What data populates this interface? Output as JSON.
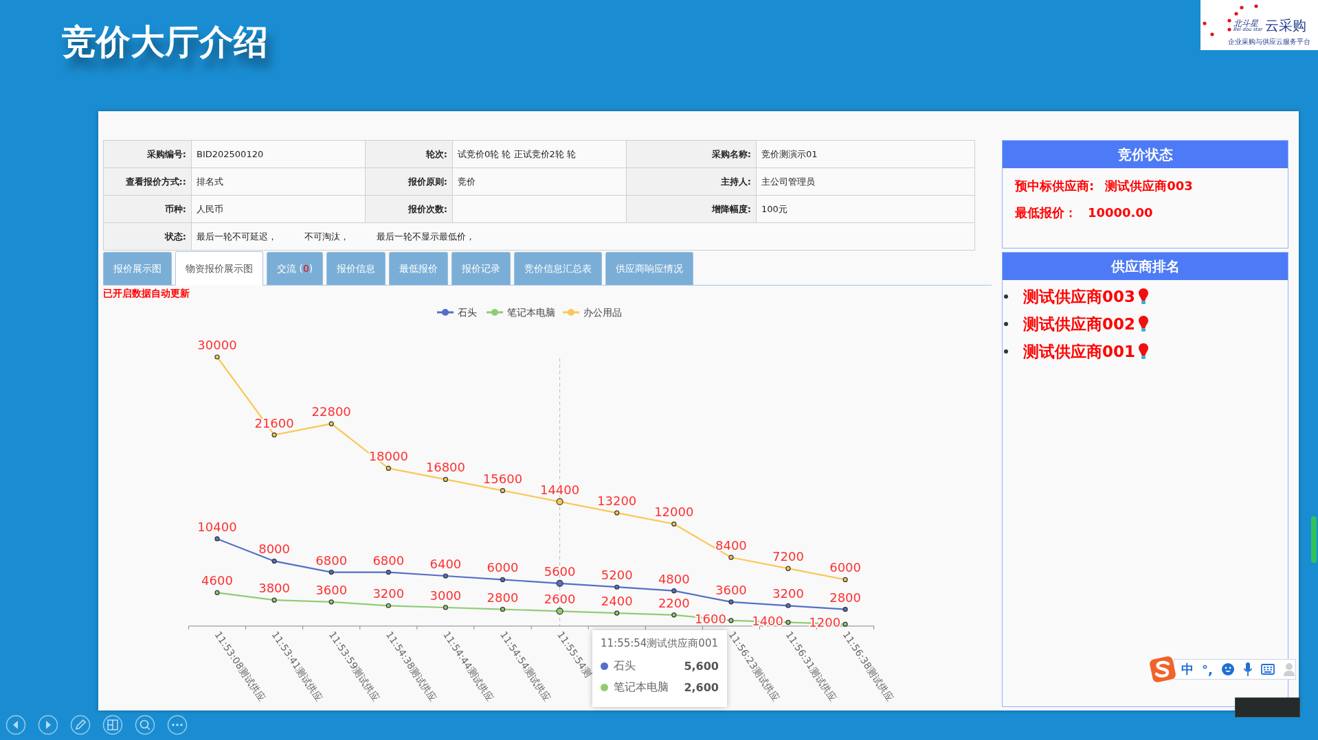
{
  "slide": {
    "title": "竞价大厅介绍"
  },
  "logo": {
    "brand": "北斗星",
    "brand_latin": "Bei dou star",
    "product": "云采购",
    "slogan": "企业采购与供应云服务平台"
  },
  "info_table": {
    "rows": [
      [
        {
          "label": "采购编号:",
          "value": "BID202500120"
        },
        {
          "label": "轮次:",
          "value": "试竞价0轮 轮 正试竞价2轮 轮"
        },
        {
          "label": "采购名称:",
          "value": "竞价测演示01"
        }
      ],
      [
        {
          "label": "查看报价方式::",
          "value": "排名式"
        },
        {
          "label": "报价原则:",
          "value": "竞价"
        },
        {
          "label": "主持人:",
          "value": "主公司管理员"
        }
      ],
      [
        {
          "label": "币种:",
          "value": "人民币"
        },
        {
          "label": "报价次数:"
        },
        {
          "label": "增降幅度:",
          "value": "100元"
        }
      ]
    ],
    "status": {
      "label": "状态:",
      "values": [
        "最后一轮不可延迟，",
        "不可淘汰，",
        "最后一轮不显示最低价，"
      ]
    }
  },
  "tabs": [
    {
      "label": "报价展示图",
      "selected": false
    },
    {
      "label": "物资报价展示图",
      "selected": true
    },
    {
      "label": "交流 (",
      "count": "0",
      "label_end": ")",
      "selected": false
    },
    {
      "label": "报价信息",
      "selected": false
    },
    {
      "label": "最低报价",
      "selected": false
    },
    {
      "label": "报价记录",
      "selected": false
    },
    {
      "label": "竞价信息汇总表",
      "selected": false
    },
    {
      "label": "供应商响应情况",
      "selected": false
    }
  ],
  "auto_update_notice": "已开启数据自动更新",
  "chart": {
    "points_hovered": [
      false,
      false,
      false,
      false,
      false,
      false,
      true,
      false,
      false,
      false,
      false,
      false
    ],
    "chart_data": {
      "type": "line",
      "categories": [
        "11:53:08测试供应",
        "11:53:41测试供应",
        "11:53:59测试供应",
        "11:54:38测试供应",
        "11:54:44测试供应",
        "11:54:54测试供应",
        "11:55:54测",
        null,
        null,
        "11:56:23测试供应",
        "11:56:31测试供应",
        "11:56:38测试供应"
      ],
      "ylim": [
        1000,
        30000
      ],
      "data_labels": true,
      "legend": "top",
      "series": [
        {
          "name": "石头",
          "color": "#5470c6",
          "marker": "circle",
          "values": [
            10400,
            8000,
            6800,
            6800,
            6400,
            6000,
            5600,
            5200,
            4800,
            3600,
            3200,
            2800
          ]
        },
        {
          "name": "笔记本电脑",
          "color": "#91cc75",
          "marker": "circle",
          "values": [
            4600,
            3800,
            3600,
            3200,
            3000,
            2800,
            2600,
            2400,
            2200,
            1600,
            1400,
            1200
          ]
        },
        {
          "name": "办公用品",
          "color": "#fac858",
          "marker": "circle",
          "values": [
            30000,
            21600,
            22800,
            18000,
            16800,
            15600,
            14400,
            13200,
            12000,
            8400,
            7200,
            6000
          ]
        }
      ]
    },
    "tooltip": {
      "title": "11:55:54测试供应商001",
      "rows": [
        {
          "series": "石头",
          "value": "5,600"
        },
        {
          "series": "笔记本电脑",
          "value": "2,600"
        }
      ]
    }
  },
  "bid_status": {
    "title": "竞价状态",
    "lines": [
      {
        "label": "预中标供应商:",
        "value": "测试供应商003"
      },
      {
        "label": "最低报价：",
        "value": "10000.00"
      }
    ]
  },
  "supplier_ranking": {
    "title": "供应商排名",
    "items": [
      "测试供应商003",
      "测试供应商002",
      "测试供应商001"
    ]
  },
  "ime_toolbar": {
    "mode": "中",
    "punctuation": "°,"
  }
}
